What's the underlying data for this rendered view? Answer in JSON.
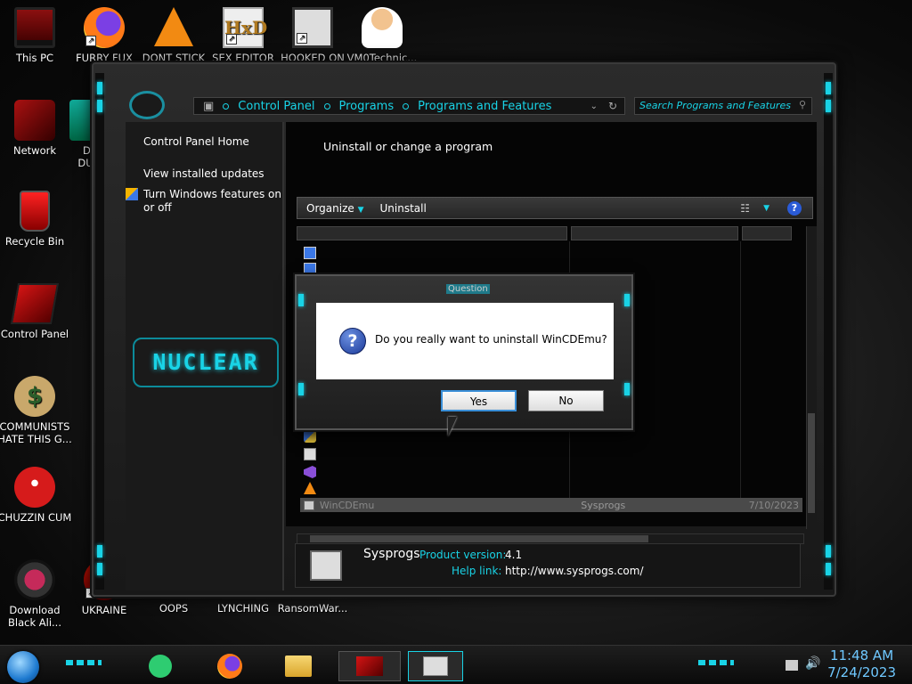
{
  "desktop": {
    "icons": [
      {
        "label": "This PC",
        "icon": "monitor-icon"
      },
      {
        "label": "FURRY FUX",
        "icon": "firefox-icon"
      },
      {
        "label": "DONT STICK",
        "icon": "vlc-cone-icon"
      },
      {
        "label": "SEX EDITOR",
        "icon": "hxd-icon"
      },
      {
        "label": "HOOKED ON",
        "icon": "app-icon"
      },
      {
        "label": "VM0Technic...",
        "icon": "doctor-icon"
      },
      {
        "label": "Network",
        "icon": "network-icon"
      },
      {
        "label": "D I\nDUM",
        "icon": "app-icon"
      },
      {
        "label": "Recycle Bin",
        "icon": "recycle-bin-icon"
      },
      {
        "label": "Control Panel",
        "icon": "control-panel-icon"
      },
      {
        "label": "COMMUNISTS HATE THIS G...",
        "icon": "money-bag-icon"
      },
      {
        "label": "CHUZZIN CUM",
        "icon": "red-creature-icon"
      },
      {
        "label": "Download Black Ali...",
        "icon": "alien-icon"
      },
      {
        "label": "UKRAINE",
        "icon": "app-icon"
      },
      {
        "label": "OOPS",
        "icon": "app-icon"
      },
      {
        "label": "LYNCHING",
        "icon": "app-icon"
      },
      {
        "label": "RansomWar...",
        "icon": "app-icon"
      }
    ]
  },
  "explorer": {
    "address": {
      "crumbs": [
        "Control Panel",
        "Programs",
        "Programs and Features"
      ]
    },
    "search_placeholder": "Search Programs and Features",
    "nav": {
      "home": "Control Panel Home",
      "updates": "View installed updates",
      "features": "Turn Windows features on or off"
    },
    "logo_text": "NUCLEAR",
    "content_title": "Uninstall or change a program",
    "toolbar": {
      "organize": "Organize",
      "uninstall": "Uninstall"
    },
    "selected_row": {
      "name": "WinCDEmu",
      "publisher": "Sysprogs",
      "date": "7/10/2023"
    },
    "details": {
      "publisher": "Sysprogs",
      "version_label": "Product version:",
      "version": "4.1",
      "help_label": "Help link:",
      "help_url": "http://www.sysprogs.com/"
    }
  },
  "dialog": {
    "title": "Question",
    "message": "Do you really want to uninstall WinCDEmu?",
    "yes_label": "Yes",
    "no_label": "No"
  },
  "taskbar": {
    "time": "11:48 AM",
    "date": "7/24/2023"
  },
  "colors": {
    "accent": "#19d3e6",
    "clock": "#6fc8ff"
  }
}
